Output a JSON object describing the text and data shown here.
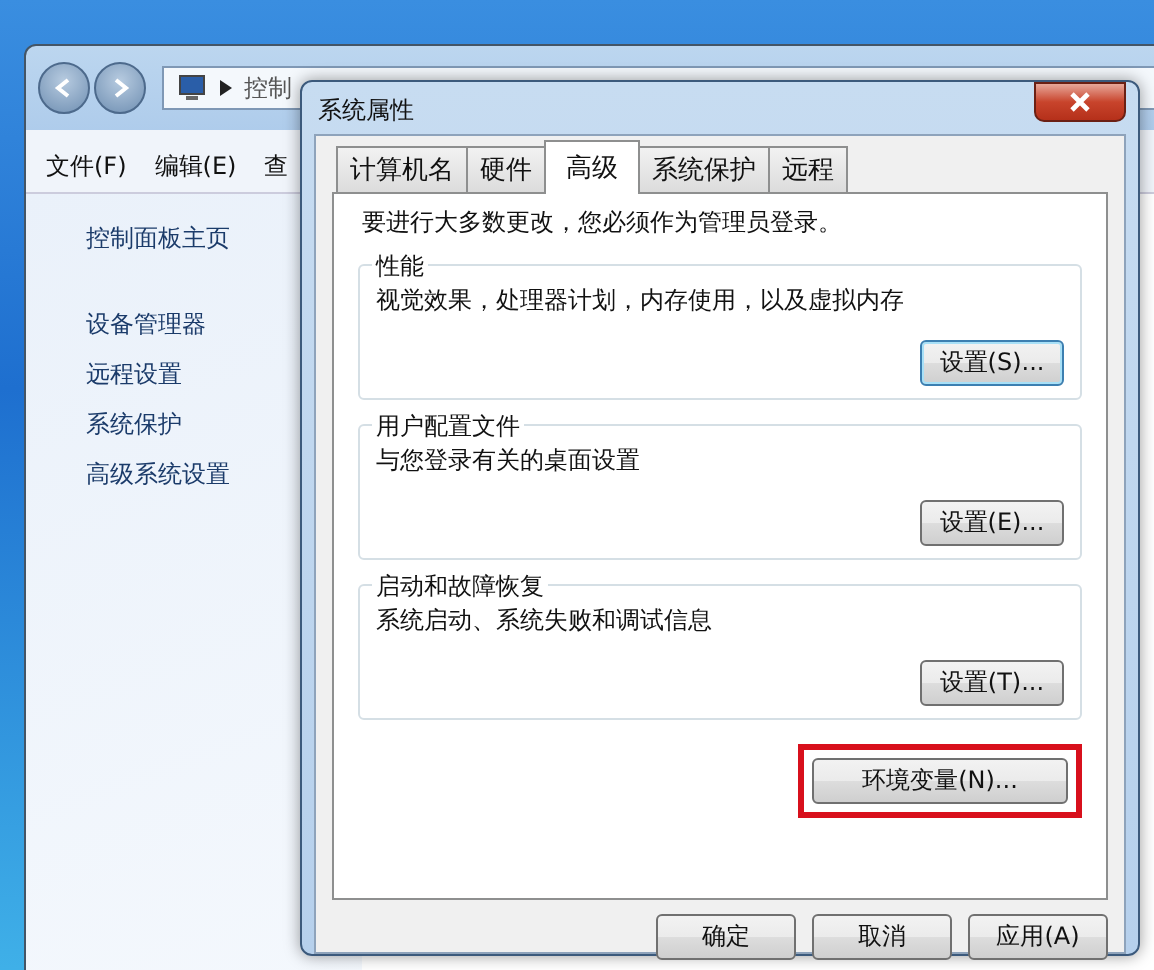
{
  "explorer": {
    "breadcrumb": [
      "控制"
    ],
    "menu": [
      "文件(F)",
      "编辑(E)",
      "查"
    ],
    "sidebar": {
      "home": "控制面板主页",
      "links": [
        "设备管理器",
        "远程设置",
        "系统保护",
        "高级系统设置"
      ]
    }
  },
  "dialog": {
    "title": "系统属性",
    "tabs": [
      {
        "label": "计算机名",
        "selected": false
      },
      {
        "label": "硬件",
        "selected": false
      },
      {
        "label": "高级",
        "selected": true
      },
      {
        "label": "系统保护",
        "selected": false
      },
      {
        "label": "远程",
        "selected": false
      }
    ],
    "notice": "要进行大多数更改，您必须作为管理员登录。",
    "groups": [
      {
        "title": "性能",
        "description": "视觉效果，处理器计划，内存使用，以及虚拟内存",
        "button": "设置(S)...",
        "focused": true
      },
      {
        "title": "用户配置文件",
        "description": "与您登录有关的桌面设置",
        "button": "设置(E)...",
        "focused": false
      },
      {
        "title": "启动和故障恢复",
        "description": "系统启动、系统失败和调试信息",
        "button": "设置(T)...",
        "focused": false
      }
    ],
    "env_button": {
      "label": "环境变量(N)...",
      "highlighted": true
    },
    "buttons": [
      "确定",
      "取消",
      "应用(A)"
    ]
  }
}
